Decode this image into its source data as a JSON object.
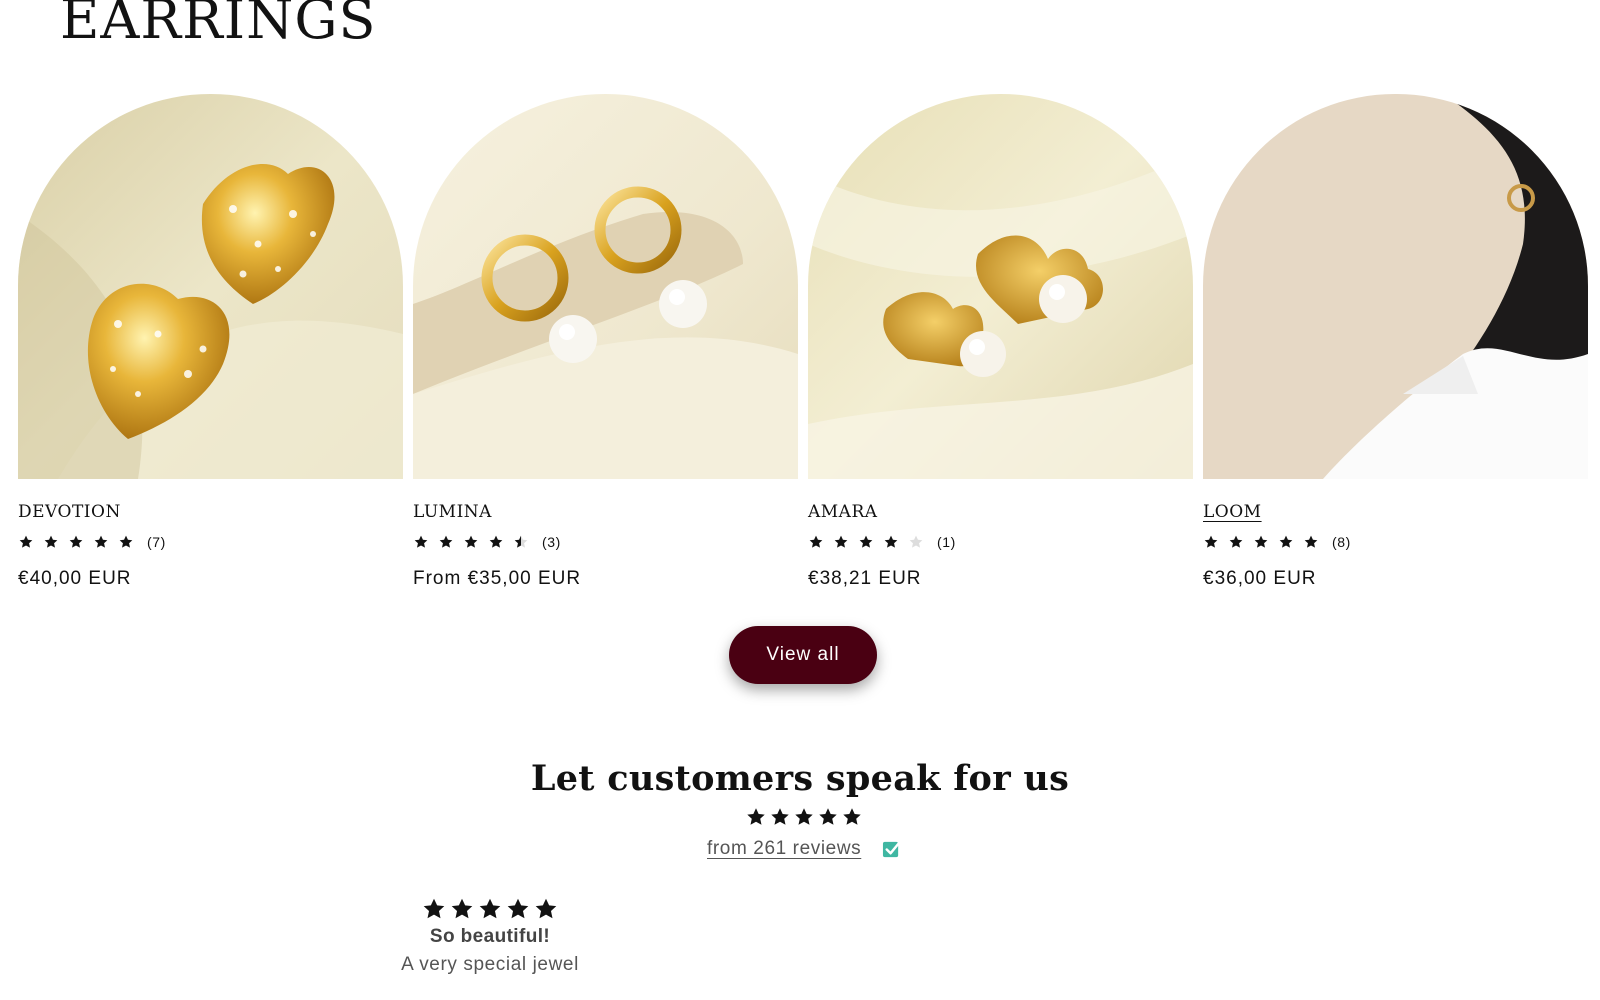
{
  "section": {
    "title": "EARRINGS"
  },
  "products": [
    {
      "name": "DEVOTION",
      "rating": 5,
      "review_count": "(7)",
      "price": "€40,00 EUR",
      "image": "gold-heart-earrings"
    },
    {
      "name": "LUMINA",
      "rating": 4.5,
      "review_count": "(3)",
      "price": "From €35,00 EUR",
      "image": "gold-hoop-pearl-earrings"
    },
    {
      "name": "AMARA",
      "rating": 4,
      "review_count": "(1)",
      "price": "€38,21 EUR",
      "image": "ginkgo-leaf-pearl-earrings"
    },
    {
      "name": "LOOM",
      "rating": 5,
      "review_count": "(8)",
      "price": "€36,00 EUR",
      "image": "model-wearing-earring"
    }
  ],
  "actions": {
    "view_all_label": "View all"
  },
  "reviews": {
    "heading": "Let customers speak for us",
    "summary_rating": 5,
    "link_text": "from 261 reviews",
    "verified_icon": "verified-check-icon",
    "featured": {
      "rating": 5,
      "title": "So beautiful!",
      "body": "A very special jewel"
    }
  },
  "colors": {
    "accent_button": "#4a0012",
    "verified": "#3fb7a2",
    "text": "#121212",
    "star": "#121212",
    "star_empty": "#dddddd"
  }
}
